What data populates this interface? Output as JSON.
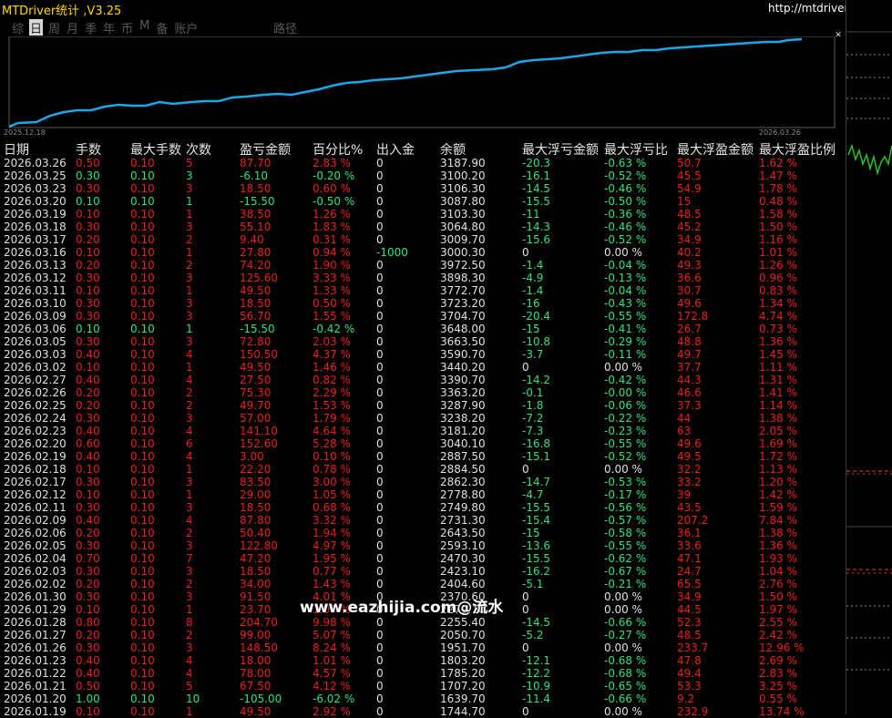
{
  "app": {
    "title": "MTDriver统计 ,V3.25",
    "url": "http://mtdriver.cn"
  },
  "tabs": [
    "综",
    "日",
    "周",
    "月",
    "季",
    "年",
    "币",
    "M",
    "备",
    "账户"
  ],
  "active_tab": "日",
  "extra_tab": "路径",
  "close_label": "✕",
  "chart": {
    "start_date": "2025.12.18",
    "end_date": "2026.03.26",
    "line_color": "#19a8ec"
  },
  "columns": [
    "日期",
    "手数",
    "最大手数",
    "次数",
    "盈亏金额",
    "百分比%",
    "出入金",
    "余额",
    "最大浮亏金额",
    "最大浮亏比",
    "最大浮盈金额",
    "最大浮盈比例"
  ],
  "colors": {
    "loss": "#e8211b",
    "gain": "#2be37a"
  },
  "rows": [
    [
      "2026.03.26",
      "0.50",
      "0.10",
      "5",
      "87.70",
      "2.83 %",
      "0",
      "3187.90",
      "-20.3",
      "-0.63 %",
      "50.7",
      "1.62 %"
    ],
    [
      "2026.03.25",
      "0.30",
      "0.10",
      "3",
      "-6.10",
      "-0.20 %",
      "0",
      "3100.20",
      "-16.1",
      "-0.52 %",
      "45.5",
      "1.47 %"
    ],
    [
      "2026.03.23",
      "0.30",
      "0.10",
      "3",
      "18.50",
      "0.60 %",
      "0",
      "3106.30",
      "-14.5",
      "-0.46 %",
      "54.9",
      "1.78 %"
    ],
    [
      "2026.03.20",
      "0.10",
      "0.10",
      "1",
      "-15.50",
      "-0.50 %",
      "0",
      "3087.80",
      "-15.5",
      "-0.50 %",
      "15",
      "0.48 %"
    ],
    [
      "2026.03.19",
      "0.10",
      "0.10",
      "1",
      "38.50",
      "1.26 %",
      "0",
      "3103.30",
      "-11",
      "-0.36 %",
      "48.5",
      "1.58 %"
    ],
    [
      "2026.03.18",
      "0.30",
      "0.10",
      "3",
      "55.10",
      "1.83 %",
      "0",
      "3064.80",
      "-14.3",
      "-0.46 %",
      "45.2",
      "1.50 %"
    ],
    [
      "2026.03.17",
      "0.20",
      "0.10",
      "2",
      "9.40",
      "0.31 %",
      "0",
      "3009.70",
      "-15.6",
      "-0.52 %",
      "34.9",
      "1.16 %"
    ],
    [
      "2026.03.16",
      "0.10",
      "0.10",
      "1",
      "27.80",
      "0.94 %",
      "-1000",
      "3000.30",
      "0",
      "0.00 %",
      "40.2",
      "1.01 %"
    ],
    [
      "2026.03.13",
      "0.20",
      "0.10",
      "2",
      "74.20",
      "1.90 %",
      "0",
      "3972.50",
      "-1.4",
      "-0.04 %",
      "49.3",
      "1.26 %"
    ],
    [
      "2026.03.12",
      "0.30",
      "0.10",
      "3",
      "125.60",
      "3.33 %",
      "0",
      "3898.30",
      "-4.9",
      "-0.13 %",
      "36.6",
      "0.96 %"
    ],
    [
      "2026.03.11",
      "0.10",
      "0.10",
      "1",
      "49.50",
      "1.33 %",
      "0",
      "3772.70",
      "-1.4",
      "-0.04 %",
      "30.7",
      "0.83 %"
    ],
    [
      "2026.03.10",
      "0.30",
      "0.10",
      "3",
      "18.50",
      "0.50 %",
      "0",
      "3723.20",
      "-16",
      "-0.43 %",
      "49.6",
      "1.34 %"
    ],
    [
      "2026.03.09",
      "0.30",
      "0.10",
      "3",
      "56.70",
      "1.55 %",
      "0",
      "3704.70",
      "-20.4",
      "-0.55 %",
      "172.8",
      "4.74 %"
    ],
    [
      "2026.03.06",
      "0.10",
      "0.10",
      "1",
      "-15.50",
      "-0.42 %",
      "0",
      "3648.00",
      "-15",
      "-0.41 %",
      "26.7",
      "0.73 %"
    ],
    [
      "2026.03.05",
      "0.30",
      "0.10",
      "3",
      "72.80",
      "2.03 %",
      "0",
      "3663.50",
      "-10.8",
      "-0.29 %",
      "48.8",
      "1.36 %"
    ],
    [
      "2026.03.03",
      "0.40",
      "0.10",
      "4",
      "150.50",
      "4.37 %",
      "0",
      "3590.70",
      "-3.7",
      "-0.11 %",
      "49.7",
      "1.45 %"
    ],
    [
      "2026.03.02",
      "0.10",
      "0.10",
      "1",
      "49.50",
      "1.46 %",
      "0",
      "3440.20",
      "0",
      "0.00 %",
      "37.7",
      "1.11 %"
    ],
    [
      "2026.02.27",
      "0.40",
      "0.10",
      "4",
      "27.50",
      "0.82 %",
      "0",
      "3390.70",
      "-14.2",
      "-0.42 %",
      "44.3",
      "1.31 %"
    ],
    [
      "2026.02.26",
      "0.20",
      "0.10",
      "2",
      "75.30",
      "2.29 %",
      "0",
      "3363.20",
      "-0.1",
      "-0.00 %",
      "46.6",
      "1.41 %"
    ],
    [
      "2026.02.25",
      "0.20",
      "0.10",
      "2",
      "49.70",
      "1.53 %",
      "0",
      "3287.90",
      "-1.8",
      "-0.06 %",
      "37.3",
      "1.14 %"
    ],
    [
      "2026.02.24",
      "0.30",
      "0.10",
      "3",
      "57.00",
      "1.79 %",
      "0",
      "3238.20",
      "-7.2",
      "-0.22 %",
      "44",
      "1.38 %"
    ],
    [
      "2026.02.23",
      "0.40",
      "0.10",
      "4",
      "141.10",
      "4.64 %",
      "0",
      "3181.20",
      "-7.3",
      "-0.23 %",
      "63",
      "2.05 %"
    ],
    [
      "2026.02.20",
      "0.60",
      "0.10",
      "6",
      "152.60",
      "5.28 %",
      "0",
      "3040.10",
      "-16.8",
      "-0.55 %",
      "49.6",
      "1.69 %"
    ],
    [
      "2026.02.19",
      "0.40",
      "0.10",
      "4",
      "3.00",
      "0.10 %",
      "0",
      "2887.50",
      "-15.1",
      "-0.52 %",
      "49.5",
      "1.72 %"
    ],
    [
      "2026.02.18",
      "0.10",
      "0.10",
      "1",
      "22.20",
      "0.78 %",
      "0",
      "2884.50",
      "0",
      "0.00 %",
      "32.2",
      "1.13 %"
    ],
    [
      "2026.02.17",
      "0.30",
      "0.10",
      "3",
      "83.50",
      "3.00 %",
      "0",
      "2862.30",
      "-14.7",
      "-0.53 %",
      "33.2",
      "1.20 %"
    ],
    [
      "2026.02.12",
      "0.10",
      "0.10",
      "1",
      "29.00",
      "1.05 %",
      "0",
      "2778.80",
      "-4.7",
      "-0.17 %",
      "39",
      "1.42 %"
    ],
    [
      "2026.02.11",
      "0.30",
      "0.10",
      "3",
      "18.50",
      "0.68 %",
      "0",
      "2749.80",
      "-15.5",
      "-0.56 %",
      "43.5",
      "1.59 %"
    ],
    [
      "2026.02.09",
      "0.40",
      "0.10",
      "4",
      "87.80",
      "3.32 %",
      "0",
      "2731.30",
      "-15.4",
      "-0.57 %",
      "207.2",
      "7.84 %"
    ],
    [
      "2026.02.06",
      "0.20",
      "0.10",
      "2",
      "50.40",
      "1.94 %",
      "0",
      "2643.50",
      "-15",
      "-0.58 %",
      "36.1",
      "1.38 %"
    ],
    [
      "2026.02.05",
      "0.30",
      "0.10",
      "3",
      "122.80",
      "4.97 %",
      "0",
      "2593.10",
      "-13.6",
      "-0.55 %",
      "33.6",
      "1.36 %"
    ],
    [
      "2026.02.04",
      "0.70",
      "0.10",
      "7",
      "47.20",
      "1.95 %",
      "0",
      "2470.30",
      "-15.5",
      "-0.62 %",
      "47.1",
      "1.93 %"
    ],
    [
      "2026.02.03",
      "0.30",
      "0.10",
      "3",
      "18.50",
      "0.77 %",
      "0",
      "2423.10",
      "-16.2",
      "-0.67 %",
      "24.7",
      "1.04 %"
    ],
    [
      "2026.02.02",
      "0.20",
      "0.10",
      "2",
      "34.00",
      "1.43 %",
      "0",
      "2404.60",
      "-5.1",
      "-0.21 %",
      "65.5",
      "2.76 %"
    ],
    [
      "2026.01.30",
      "0.30",
      "0.10",
      "3",
      "91.50",
      "4.01 %",
      "0",
      "2370.60",
      "0",
      "0.00 %",
      "34.9",
      "1.50 %"
    ],
    [
      "2026.01.29",
      "0.10",
      "0.10",
      "1",
      "23.70",
      "1.07 %",
      "0",
      "2279.10",
      "0",
      "0.00 %",
      "44.5",
      "1.97 %"
    ],
    [
      "2026.01.28",
      "0.80",
      "0.10",
      "8",
      "204.70",
      "9.98 %",
      "0",
      "2255.40",
      "-14.5",
      "-0.66 %",
      "52.3",
      "2.55 %"
    ],
    [
      "2026.01.27",
      "0.20",
      "0.10",
      "2",
      "99.00",
      "5.07 %",
      "0",
      "2050.70",
      "-5.2",
      "-0.27 %",
      "48.5",
      "2.42 %"
    ],
    [
      "2026.01.26",
      "0.30",
      "0.10",
      "3",
      "148.50",
      "8.24 %",
      "0",
      "1951.70",
      "0",
      "0.00 %",
      "233.7",
      "12.96 %"
    ],
    [
      "2026.01.23",
      "0.40",
      "0.10",
      "4",
      "18.00",
      "1.01 %",
      "0",
      "1803.20",
      "-12.1",
      "-0.68 %",
      "47.8",
      "2.69 %"
    ],
    [
      "2026.01.22",
      "0.40",
      "0.10",
      "4",
      "78.00",
      "4.57 %",
      "0",
      "1785.20",
      "-12.2",
      "-0.68 %",
      "49.4",
      "2.83 %"
    ],
    [
      "2026.01.21",
      "0.50",
      "0.10",
      "5",
      "67.50",
      "4.12 %",
      "0",
      "1707.20",
      "-10.9",
      "-0.65 %",
      "53.3",
      "3.25 %"
    ],
    [
      "2026.01.20",
      "1.00",
      "0.10",
      "10",
      "-105.00",
      "-6.02 %",
      "0",
      "1639.70",
      "-11.4",
      "-0.66 %",
      "9.2",
      "0.55 %"
    ],
    [
      "2026.01.19",
      "0.10",
      "0.10",
      "1",
      "49.50",
      "2.92 %",
      "0",
      "1744.70",
      "0",
      "0.00 %",
      "232.9",
      "13.74 %"
    ]
  ],
  "watermark": "www.eazhijia.com@流水"
}
